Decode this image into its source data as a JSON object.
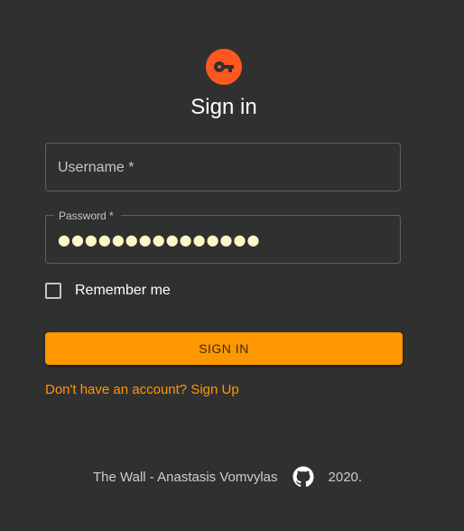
{
  "header": {
    "avatar_icon": "key-icon",
    "avatar_color": "#ff5722",
    "title": "Sign in"
  },
  "form": {
    "username_label": "Username *",
    "username_value": "",
    "password_label": "Password *",
    "password_value": "●●●●●●●●●●●●●●●",
    "remember_label": "Remember me",
    "remember_checked": false,
    "submit_label": "SIGN IN",
    "accent_color": "#ff9800"
  },
  "links": {
    "signup": "Don't have an account? Sign Up"
  },
  "footer": {
    "text": "The Wall - Anastasis Vomvylas",
    "icon": "github-icon",
    "year": "2020."
  }
}
